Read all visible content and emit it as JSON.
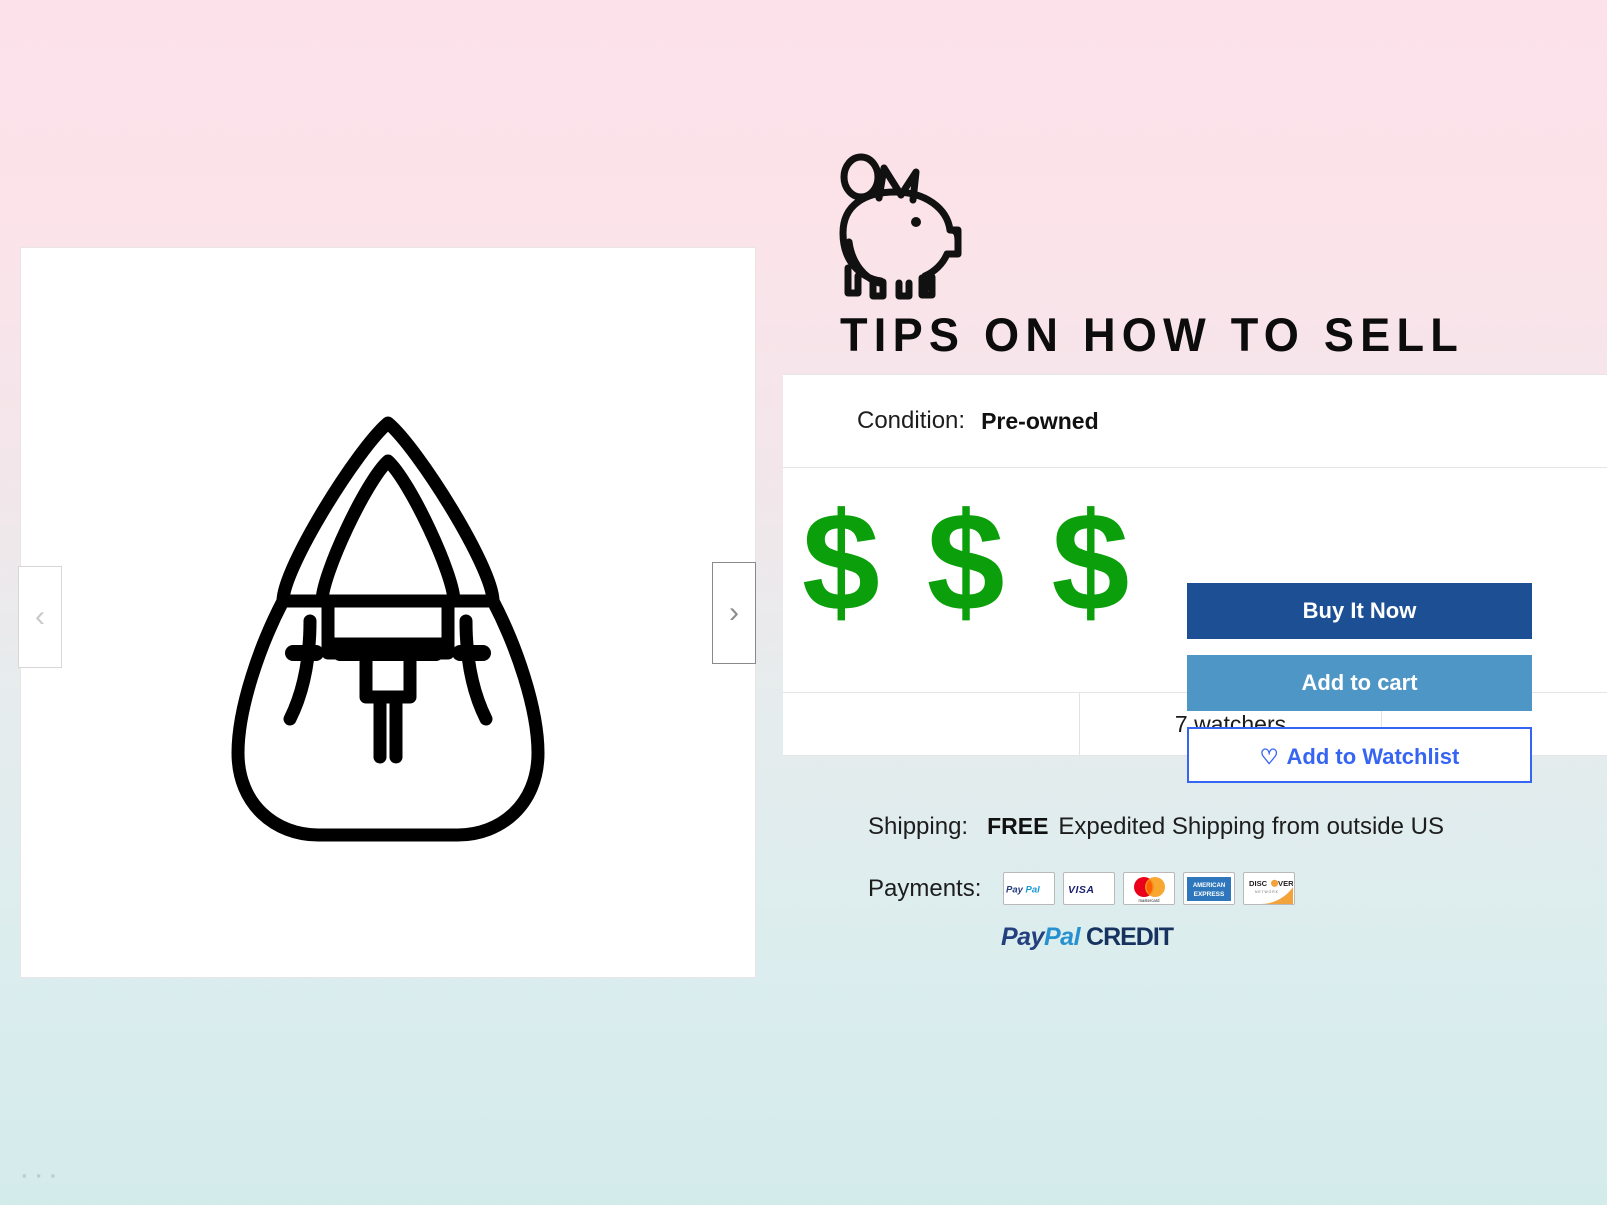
{
  "promo": {
    "icon": "piggy-bank-icon",
    "title": "TIPS ON HOW TO SELL"
  },
  "gallery": {
    "image_alt": "handbag-line-icon",
    "prev_label": "‹",
    "next_label": "›"
  },
  "listing": {
    "condition_label": "Condition:",
    "condition_value": "Pre-owned",
    "price_display": "$ $ $",
    "buy_it_now_label": "Buy It Now",
    "add_to_cart_label": "Add to cart",
    "add_to_watchlist_label": "Add to Watchlist",
    "watchlist_heart": "♡",
    "watchers_text": "7 watchers"
  },
  "fulfilment": {
    "shipping_label": "Shipping:",
    "shipping_free": "FREE",
    "shipping_description": "Expedited Shipping from outside US",
    "payments_label": "Payments:",
    "payment_methods": [
      "PayPal",
      "VISA",
      "mastercard",
      "AMERICAN EXPRESS",
      "DISCOVER"
    ],
    "paypal_credit": {
      "pay": "Pay",
      "pal": "Pal",
      "credit": "CREDIT"
    }
  },
  "misc": {
    "corner_dots": "▪ ▪ ▪"
  },
  "colors": {
    "background_top": "#fce1ea",
    "background_bottom": "#d4ebec",
    "price_green": "#0ba00b",
    "buy_now_blue": "#1c4f94",
    "add_to_cart_blue": "#4d96c6",
    "watchlist_blue": "#3665f3"
  }
}
